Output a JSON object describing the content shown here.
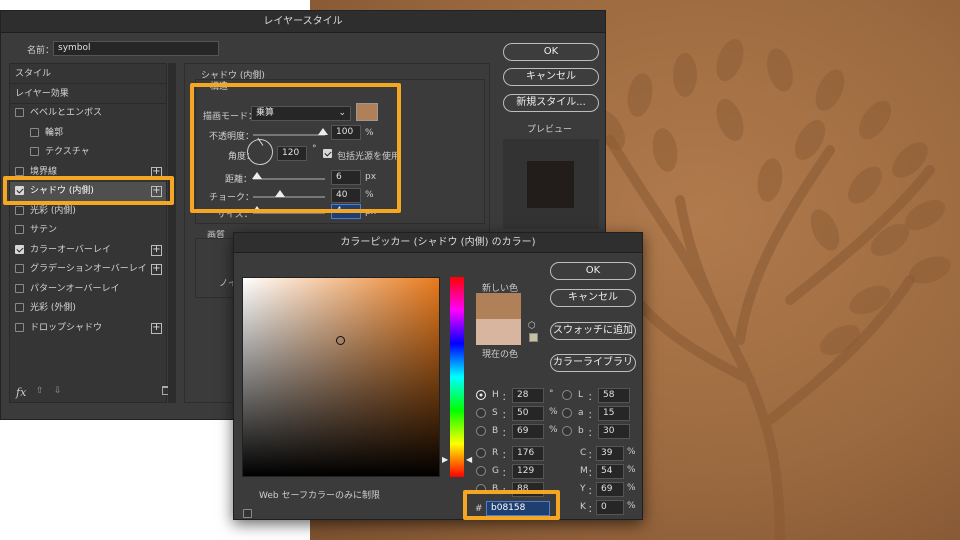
{
  "layer_style": {
    "title": "レイヤースタイル",
    "name_label": "名前：",
    "name_value": "symbol",
    "styles_header": "スタイル",
    "effects_header": "レイヤー効果",
    "items": [
      {
        "label": "ベベルとエンボス",
        "checked": false,
        "plus": false
      },
      {
        "label": "輪郭",
        "checked": false,
        "plus": false
      },
      {
        "label": "テクスチャ",
        "checked": false,
        "plus": false
      },
      {
        "label": "境界線",
        "checked": false,
        "plus": true
      },
      {
        "label": "シャドウ (内側)",
        "checked": true,
        "plus": true
      },
      {
        "label": "光彩 (内側)",
        "checked": false,
        "plus": false
      },
      {
        "label": "サテン",
        "checked": false,
        "plus": false
      },
      {
        "label": "カラーオーバーレイ",
        "checked": true,
        "plus": true
      },
      {
        "label": "グラデーションオーバーレイ",
        "checked": false,
        "plus": true
      },
      {
        "label": "パターンオーバーレイ",
        "checked": false,
        "plus": false
      },
      {
        "label": "光彩 (外側)",
        "checked": false,
        "plus": false
      },
      {
        "label": "ドロップシャドウ",
        "checked": false,
        "plus": true
      }
    ],
    "fx_label": "fx",
    "section_title": "シャドウ (内側)",
    "structure": "構造",
    "blend_mode_label": "描画モード：",
    "blend_mode_value": "乗算",
    "opacity_label": "不透明度：",
    "opacity_value": "100",
    "percent": "%",
    "angle_label": "角度：",
    "angle_value": "120",
    "degree": "°",
    "global_light_label": "包括光源を使用",
    "distance_label": "距離：",
    "distance_value": "6",
    "choke_label": "チョーク：",
    "choke_value": "40",
    "size_label": "サイズ：",
    "size_value": "4",
    "px": "px",
    "quality": "画質",
    "contour_partial": "輪",
    "noise_partial": "ノイ",
    "ok": "OK",
    "cancel": "キャンセル",
    "new_style": "新規スタイル...",
    "preview": "プレビュー",
    "shadow_color": "#b08158"
  },
  "color_picker": {
    "title": "カラーピッカー (シャドウ (内側) のカラー)",
    "new_label": "新しい色",
    "current_label": "現在の色",
    "new_color": "#b08158",
    "current_color": "#d7b59f",
    "ok": "OK",
    "cancel": "キャンセル",
    "add_swatch": "スウォッチに追加",
    "libraries": "カラーライブラリ",
    "web_only": "Web セーフカラーのみに制限",
    "fields_left": [
      {
        "key": "H",
        "value": "28",
        "unit": "°",
        "selected": true
      },
      {
        "key": "S",
        "value": "50",
        "unit": "%",
        "selected": false
      },
      {
        "key": "B",
        "value": "69",
        "unit": "%",
        "selected": false
      },
      {
        "key": "R",
        "value": "176",
        "unit": "",
        "selected": false
      },
      {
        "key": "G",
        "value": "129",
        "unit": "",
        "selected": false
      },
      {
        "key": "B",
        "value": "88",
        "unit": "",
        "selected": false
      }
    ],
    "fields_lab": [
      {
        "key": "L",
        "value": "58"
      },
      {
        "key": "a",
        "value": "15"
      },
      {
        "key": "b",
        "value": "30"
      }
    ],
    "fields_cmyk": [
      {
        "key": "C",
        "value": "39",
        "unit": "%"
      },
      {
        "key": "M",
        "value": "54",
        "unit": "%"
      },
      {
        "key": "Y",
        "value": "69",
        "unit": "%"
      },
      {
        "key": "K",
        "value": "0",
        "unit": "%"
      }
    ],
    "hash": "#",
    "hex_value": "b08158",
    "field_hue": "#e87a1c"
  },
  "highlight_color": "#f5a623"
}
